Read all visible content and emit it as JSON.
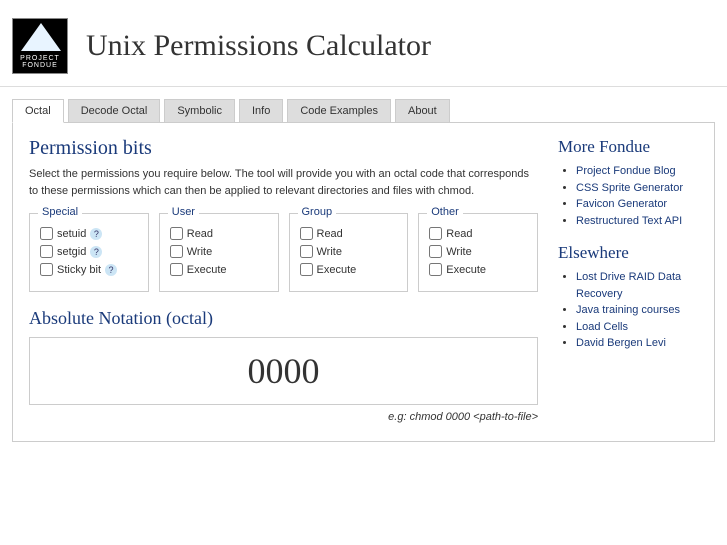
{
  "logo": {
    "line1": "PROJECT",
    "line2": "FONDUE"
  },
  "title": "Unix Permissions Calculator",
  "tabs": [
    "Octal",
    "Decode Octal",
    "Symbolic",
    "Info",
    "Code Examples",
    "About"
  ],
  "main": {
    "heading": "Permission bits",
    "intro": "Select the permissions you require below. The tool will provide you with an octal code that corresponds to these permissions which can then be applied to relevant directories and files with chmod.",
    "groups": {
      "special": {
        "legend": "Special",
        "items": [
          "setuid",
          "setgid",
          "Sticky bit"
        ]
      },
      "user": {
        "legend": "User",
        "items": [
          "Read",
          "Write",
          "Execute"
        ]
      },
      "group": {
        "legend": "Group",
        "items": [
          "Read",
          "Write",
          "Execute"
        ]
      },
      "other": {
        "legend": "Other",
        "items": [
          "Read",
          "Write",
          "Execute"
        ]
      }
    },
    "abs_heading": "Absolute Notation (octal)",
    "octal_value": "0000",
    "example": "e.g: chmod 0000 <path-to-file>"
  },
  "sidebar": {
    "more_heading": "More Fondue",
    "more_links": [
      "Project Fondue Blog",
      "CSS Sprite Generator",
      "Favicon Generator",
      "Restructured Text API"
    ],
    "elsewhere_heading": "Elsewhere",
    "elsewhere_links": [
      "Lost Drive RAID Data Recovery",
      "Java training courses",
      "Load Cells",
      "David Bergen Levi"
    ]
  }
}
